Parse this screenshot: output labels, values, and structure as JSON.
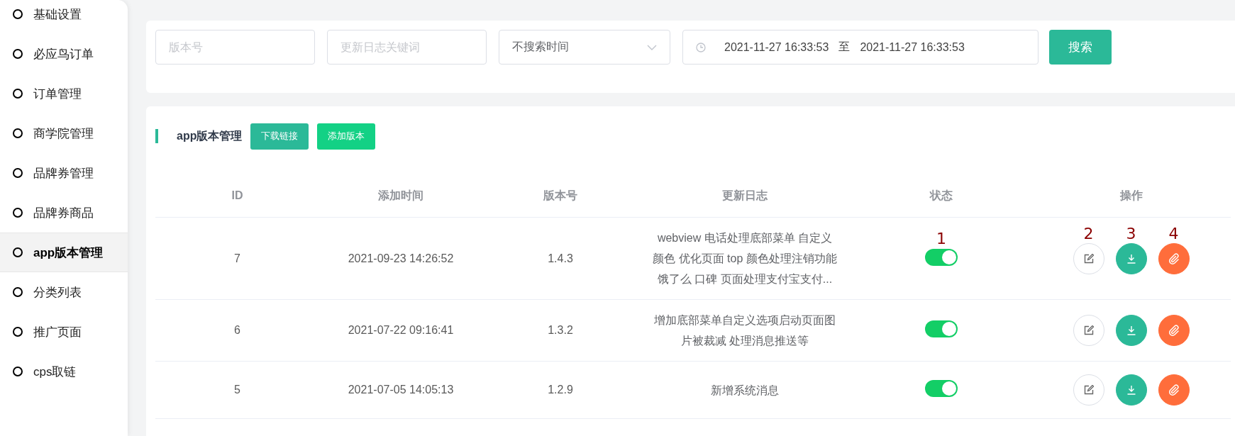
{
  "sidebar": {
    "items": [
      {
        "label": "基础设置",
        "selected": false
      },
      {
        "label": "必应鸟订单",
        "selected": false
      },
      {
        "label": "订单管理",
        "selected": false
      },
      {
        "label": "商学院管理",
        "selected": false
      },
      {
        "label": "品牌券管理",
        "selected": false
      },
      {
        "label": "品牌券商品",
        "selected": false
      },
      {
        "label": "app版本管理",
        "selected": true
      },
      {
        "label": "分类列表",
        "selected": false
      },
      {
        "label": "推广页面",
        "selected": false
      },
      {
        "label": "cps取链",
        "selected": false
      }
    ]
  },
  "search": {
    "version_placeholder": "版本号",
    "keyword_placeholder": "更新日志关键词",
    "time_mode": "不搜索时间",
    "range_start": "2021-11-27 16:33:53",
    "range_separator": "至",
    "range_end": "2021-11-27 16:33:53",
    "button": "搜索"
  },
  "panel": {
    "title": "app版本管理",
    "buttons": [
      {
        "label": "下载链接",
        "kind": "link"
      },
      {
        "label": "添加版本",
        "kind": "add"
      }
    ]
  },
  "table": {
    "columns": [
      "ID",
      "添加时间",
      "版本号",
      "更新日志",
      "状态",
      "操作"
    ],
    "rows": [
      {
        "id": "7",
        "time": "2021-09-23 14:26:52",
        "version": "1.4.3",
        "log": "webview 电话处理底部菜单 自定义颜色 优化页面 top 颜色处理注销功能饿了么 口碑 页面处理支付宝支付...",
        "enabled": true,
        "status_marker": "1",
        "actions": [
          {
            "kind": "edit",
            "marker": "2"
          },
          {
            "kind": "download",
            "marker": "3"
          },
          {
            "kind": "attach",
            "marker": "4"
          }
        ]
      },
      {
        "id": "6",
        "time": "2021-07-22 09:16:41",
        "version": "1.3.2",
        "log": "增加底部菜单自定义选项启动页面图片被裁减 处理消息推送等",
        "enabled": true,
        "actions": [
          {
            "kind": "edit"
          },
          {
            "kind": "download"
          },
          {
            "kind": "attach"
          }
        ]
      },
      {
        "id": "5",
        "time": "2021-07-05 14:05:13",
        "version": "1.2.9",
        "log": "新增系统消息",
        "enabled": true,
        "actions": [
          {
            "kind": "edit"
          },
          {
            "kind": "download"
          },
          {
            "kind": "attach"
          }
        ]
      }
    ]
  }
}
